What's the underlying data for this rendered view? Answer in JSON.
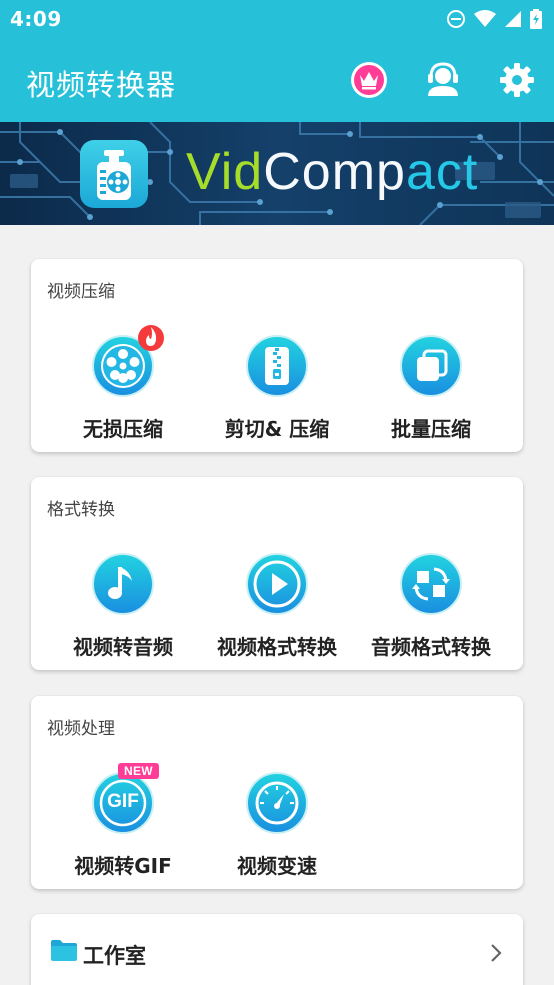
{
  "status_bar": {
    "time": "4:09"
  },
  "toolbar": {
    "title": "视频转换器",
    "vip_icon": "crown-icon",
    "support_icon": "headset-icon",
    "settings_icon": "gear-icon"
  },
  "banner": {
    "logo_part1": "Vid",
    "logo_part2": "Comp",
    "logo_part3": "act"
  },
  "sections": [
    {
      "title": "视频压缩",
      "items": [
        {
          "label": "无损压缩",
          "icon": "film-reel-icon",
          "badge": "hot"
        },
        {
          "label": "剪切& 压缩",
          "icon": "zip-icon"
        },
        {
          "label": "批量压缩",
          "icon": "stack-icon"
        }
      ]
    },
    {
      "title": "格式转换",
      "items": [
        {
          "label": "视频转音频",
          "icon": "music-note-icon"
        },
        {
          "label": "视频格式转换",
          "icon": "play-icon"
        },
        {
          "label": "音频格式转换",
          "icon": "convert-icon"
        }
      ]
    },
    {
      "title": "视频处理",
      "items": [
        {
          "label": "视频转GIF",
          "icon": "gif-icon",
          "badge": "NEW",
          "icon_text": "GIF"
        },
        {
          "label": "视频变速",
          "icon": "speedometer-icon"
        }
      ]
    }
  ],
  "studio": {
    "label": "工作室"
  },
  "colors": {
    "primary": "#26c1d9",
    "accent_pink": "#ff3c96",
    "icon_top": "#22cfe0",
    "icon_bottom": "#1a90e0"
  }
}
